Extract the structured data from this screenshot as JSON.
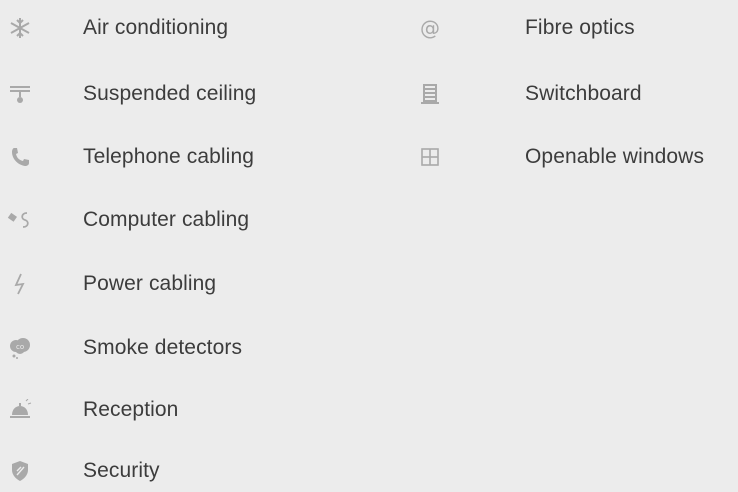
{
  "left_features": [
    {
      "label": "Air conditioning",
      "icon": "snowflake-icon"
    },
    {
      "label": "Suspended ceiling",
      "icon": "ceiling-lamp-icon"
    },
    {
      "label": "Telephone cabling",
      "icon": "telephone-icon"
    },
    {
      "label": "Computer cabling",
      "icon": "network-cable-icon"
    },
    {
      "label": "Power cabling",
      "icon": "lightning-icon"
    },
    {
      "label": "Smoke detectors",
      "icon": "smoke-co-icon"
    },
    {
      "label": "Reception",
      "icon": "service-bell-icon"
    },
    {
      "label": "Security",
      "icon": "shield-icon"
    }
  ],
  "right_features": [
    {
      "label": "Fibre optics",
      "icon": "at-sign-icon"
    },
    {
      "label": "Switchboard",
      "icon": "switchboard-icon"
    },
    {
      "label": "Openable windows",
      "icon": "window-icon"
    }
  ],
  "colors": {
    "background": "#ececec",
    "icon": "#a9a9a9",
    "text": "#3c3c3c"
  }
}
